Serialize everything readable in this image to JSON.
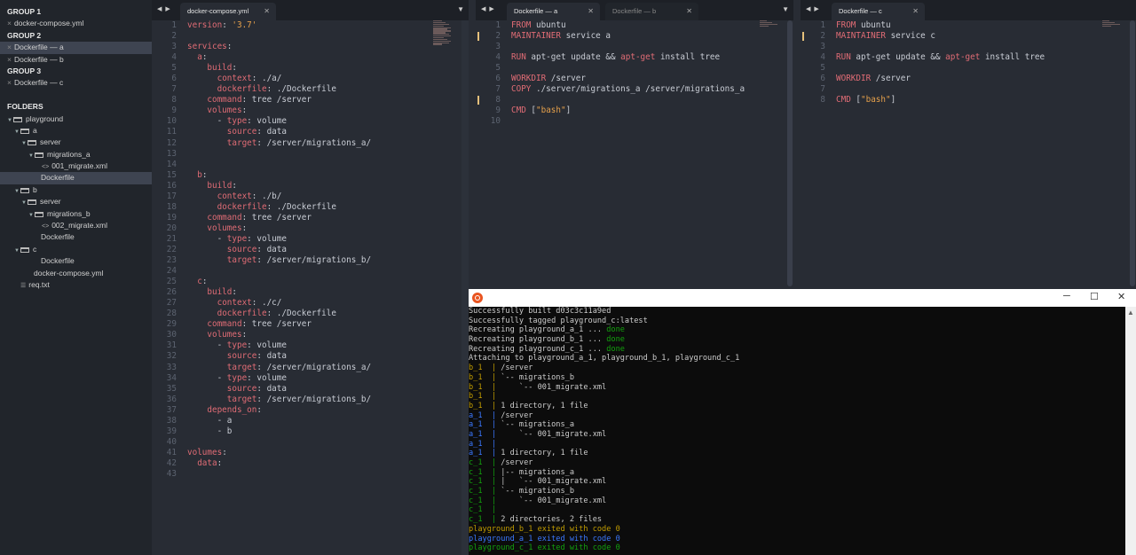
{
  "sidebar": {
    "group1": "GROUP 1",
    "group1_file": "docker-compose.yml",
    "group2": "GROUP 2",
    "group2_files": [
      "Dockerfile — a",
      "Dockerfile — b"
    ],
    "group3": "GROUP 3",
    "group3_file": "Dockerfile — c",
    "folders_header": "FOLDERS",
    "tree": [
      {
        "label": "playground",
        "kind": "folder",
        "depth": 0
      },
      {
        "label": "a",
        "kind": "folder",
        "depth": 1
      },
      {
        "label": "server",
        "kind": "folder",
        "depth": 2
      },
      {
        "label": "migrations_a",
        "kind": "folder",
        "depth": 3
      },
      {
        "label": "001_migrate.xml",
        "kind": "xml",
        "depth": 4
      },
      {
        "label": "Dockerfile",
        "kind": "file",
        "depth": 3
      },
      {
        "label": "b",
        "kind": "folder",
        "depth": 1
      },
      {
        "label": "server",
        "kind": "folder",
        "depth": 2
      },
      {
        "label": "migrations_b",
        "kind": "folder",
        "depth": 3
      },
      {
        "label": "002_migrate.xml",
        "kind": "xml",
        "depth": 4
      },
      {
        "label": "Dockerfile",
        "kind": "file",
        "depth": 3
      },
      {
        "label": "c",
        "kind": "folder",
        "depth": 1
      },
      {
        "label": "Dockerfile",
        "kind": "file",
        "depth": 3
      },
      {
        "label": "docker-compose.yml",
        "kind": "file",
        "depth": 2
      },
      {
        "label": "req.txt",
        "kind": "txt",
        "depth": 1
      }
    ]
  },
  "pane1": {
    "tab": "docker-compose.yml",
    "lines": [
      [
        [
          "k",
          "version"
        ],
        [
          "t",
          ": "
        ],
        [
          "s",
          "'3.7'"
        ]
      ],
      [],
      [
        [
          "k",
          "services"
        ],
        [
          "t",
          ":"
        ]
      ],
      [
        [
          "t",
          "  "
        ],
        [
          "k",
          "a"
        ],
        [
          "t",
          ":"
        ]
      ],
      [
        [
          "t",
          "    "
        ],
        [
          "k",
          "build"
        ],
        [
          "t",
          ":"
        ]
      ],
      [
        [
          "t",
          "      "
        ],
        [
          "k",
          "context"
        ],
        [
          "t",
          ": ./a/"
        ]
      ],
      [
        [
          "t",
          "      "
        ],
        [
          "k",
          "dockerfile"
        ],
        [
          "t",
          ": ./Dockerfile"
        ]
      ],
      [
        [
          "t",
          "    "
        ],
        [
          "k",
          "command"
        ],
        [
          "t",
          ": tree /server"
        ]
      ],
      [
        [
          "t",
          "    "
        ],
        [
          "k",
          "volumes"
        ],
        [
          "t",
          ":"
        ]
      ],
      [
        [
          "t",
          "      - "
        ],
        [
          "k",
          "type"
        ],
        [
          "t",
          ": volume"
        ]
      ],
      [
        [
          "t",
          "        "
        ],
        [
          "k",
          "source"
        ],
        [
          "t",
          ": data"
        ]
      ],
      [
        [
          "t",
          "        "
        ],
        [
          "k",
          "target"
        ],
        [
          "t",
          ": /server/migrations_a/"
        ]
      ],
      [],
      [],
      [
        [
          "t",
          "  "
        ],
        [
          "k",
          "b"
        ],
        [
          "t",
          ":"
        ]
      ],
      [
        [
          "t",
          "    "
        ],
        [
          "k",
          "build"
        ],
        [
          "t",
          ":"
        ]
      ],
      [
        [
          "t",
          "      "
        ],
        [
          "k",
          "context"
        ],
        [
          "t",
          ": ./b/"
        ]
      ],
      [
        [
          "t",
          "      "
        ],
        [
          "k",
          "dockerfile"
        ],
        [
          "t",
          ": ./Dockerfile"
        ]
      ],
      [
        [
          "t",
          "    "
        ],
        [
          "k",
          "command"
        ],
        [
          "t",
          ": tree /server"
        ]
      ],
      [
        [
          "t",
          "    "
        ],
        [
          "k",
          "volumes"
        ],
        [
          "t",
          ":"
        ]
      ],
      [
        [
          "t",
          "      - "
        ],
        [
          "k",
          "type"
        ],
        [
          "t",
          ": volume"
        ]
      ],
      [
        [
          "t",
          "        "
        ],
        [
          "k",
          "source"
        ],
        [
          "t",
          ": data"
        ]
      ],
      [
        [
          "t",
          "        "
        ],
        [
          "k",
          "target"
        ],
        [
          "t",
          ": /server/migrations_b/"
        ]
      ],
      [],
      [
        [
          "t",
          "  "
        ],
        [
          "k",
          "c"
        ],
        [
          "t",
          ":"
        ]
      ],
      [
        [
          "t",
          "    "
        ],
        [
          "k",
          "build"
        ],
        [
          "t",
          ":"
        ]
      ],
      [
        [
          "t",
          "      "
        ],
        [
          "k",
          "context"
        ],
        [
          "t",
          ": ./c/"
        ]
      ],
      [
        [
          "t",
          "      "
        ],
        [
          "k",
          "dockerfile"
        ],
        [
          "t",
          ": ./Dockerfile"
        ]
      ],
      [
        [
          "t",
          "    "
        ],
        [
          "k",
          "command"
        ],
        [
          "t",
          ": tree /server"
        ]
      ],
      [
        [
          "t",
          "    "
        ],
        [
          "k",
          "volumes"
        ],
        [
          "t",
          ":"
        ]
      ],
      [
        [
          "t",
          "      - "
        ],
        [
          "k",
          "type"
        ],
        [
          "t",
          ": volume"
        ]
      ],
      [
        [
          "t",
          "        "
        ],
        [
          "k",
          "source"
        ],
        [
          "t",
          ": data"
        ]
      ],
      [
        [
          "t",
          "        "
        ],
        [
          "k",
          "target"
        ],
        [
          "t",
          ": /server/migrations_a/"
        ]
      ],
      [
        [
          "t",
          "      - "
        ],
        [
          "k",
          "type"
        ],
        [
          "t",
          ": volume"
        ]
      ],
      [
        [
          "t",
          "        "
        ],
        [
          "k",
          "source"
        ],
        [
          "t",
          ": data"
        ]
      ],
      [
        [
          "t",
          "        "
        ],
        [
          "k",
          "target"
        ],
        [
          "t",
          ": /server/migrations_b/"
        ]
      ],
      [
        [
          "t",
          "    "
        ],
        [
          "k",
          "depends_on"
        ],
        [
          "t",
          ":"
        ]
      ],
      [
        [
          "t",
          "      - a"
        ]
      ],
      [
        [
          "t",
          "      - b"
        ]
      ],
      [],
      [
        [
          "k",
          "volumes"
        ],
        [
          "t",
          ":"
        ]
      ],
      [
        [
          "t",
          "  "
        ],
        [
          "k",
          "data"
        ],
        [
          "t",
          ":"
        ]
      ],
      []
    ]
  },
  "pane2": {
    "tabs": [
      "Dockerfile — a",
      "Dockerfile — b"
    ],
    "modified_lines": [
      1,
      7
    ],
    "lines": [
      [
        [
          "k",
          "FROM"
        ],
        [
          "t",
          " ubuntu"
        ]
      ],
      [
        [
          "k",
          "MAINTAINER"
        ],
        [
          "t",
          " service a"
        ]
      ],
      [],
      [
        [
          "k",
          "RUN"
        ],
        [
          "t",
          " apt-get update && "
        ],
        [
          "k",
          "apt-get"
        ],
        [
          "t",
          " install tree"
        ]
      ],
      [],
      [
        [
          "k",
          "WORKDIR"
        ],
        [
          "t",
          " /server"
        ]
      ],
      [
        [
          "k",
          "COPY"
        ],
        [
          "t",
          " ./server/migrations_a /server/migrations_a"
        ]
      ],
      [],
      [
        [
          "k",
          "CMD"
        ],
        [
          "t",
          " ["
        ],
        [
          "s",
          "\"bash\""
        ],
        [
          "t",
          "]"
        ]
      ],
      []
    ]
  },
  "pane3": {
    "tab": "Dockerfile — c",
    "modified_lines": [
      1
    ],
    "lines": [
      [
        [
          "k",
          "FROM"
        ],
        [
          "t",
          " ubuntu"
        ]
      ],
      [
        [
          "k",
          "MAINTAINER"
        ],
        [
          "t",
          " service c"
        ]
      ],
      [],
      [
        [
          "k",
          "RUN"
        ],
        [
          "t",
          " apt-get update && "
        ],
        [
          "k",
          "apt-get"
        ],
        [
          "t",
          " install tree"
        ]
      ],
      [],
      [
        [
          "k",
          "WORKDIR"
        ],
        [
          "t",
          " /server"
        ]
      ],
      [],
      [
        [
          "k",
          "CMD"
        ],
        [
          "t",
          " ["
        ],
        [
          "s",
          "\"bash\""
        ],
        [
          "t",
          "]"
        ]
      ]
    ]
  },
  "terminal": {
    "controls": [
      "─",
      "☐",
      "✕"
    ],
    "lines": [
      [
        [
          "w",
          "Successfully built d03c3c11a9ed"
        ]
      ],
      [
        [
          "w",
          "Successfully tagged playground_c:latest"
        ]
      ],
      [
        [
          "w",
          "Recreating playground_a_1 ... "
        ],
        [
          "g",
          "done"
        ]
      ],
      [
        [
          "w",
          "Recreating playground_b_1 ... "
        ],
        [
          "g",
          "done"
        ]
      ],
      [
        [
          "w",
          "Recreating playground_c_1 ... "
        ],
        [
          "g",
          "done"
        ]
      ],
      [
        [
          "w",
          "Attaching to playground_a_1, playground_b_1, playground_c_1"
        ]
      ],
      [
        [
          "y",
          "b_1  | "
        ],
        [
          "w",
          "/server"
        ]
      ],
      [
        [
          "y",
          "b_1  | "
        ],
        [
          "w",
          "`-- migrations_b"
        ]
      ],
      [
        [
          "y",
          "b_1  | "
        ],
        [
          "w",
          "    `-- 001_migrate.xml"
        ]
      ],
      [
        [
          "y",
          "b_1  | "
        ]
      ],
      [
        [
          "y",
          "b_1  | "
        ],
        [
          "w",
          "1 directory, 1 file"
        ]
      ],
      [
        [
          "b",
          "a_1  | "
        ],
        [
          "w",
          "/server"
        ]
      ],
      [
        [
          "b",
          "a_1  | "
        ],
        [
          "w",
          "`-- migrations_a"
        ]
      ],
      [
        [
          "b",
          "a_1  | "
        ],
        [
          "w",
          "    `-- 001_migrate.xml"
        ]
      ],
      [
        [
          "b",
          "a_1  | "
        ]
      ],
      [
        [
          "b",
          "a_1  | "
        ],
        [
          "w",
          "1 directory, 1 file"
        ]
      ],
      [
        [
          "g",
          "c_1  | "
        ],
        [
          "w",
          "/server"
        ]
      ],
      [
        [
          "g",
          "c_1  | "
        ],
        [
          "w",
          "|-- migrations_a"
        ]
      ],
      [
        [
          "g",
          "c_1  | "
        ],
        [
          "w",
          "|   `-- 001_migrate.xml"
        ]
      ],
      [
        [
          "g",
          "c_1  | "
        ],
        [
          "w",
          "`-- migrations_b"
        ]
      ],
      [
        [
          "g",
          "c_1  | "
        ],
        [
          "w",
          "    `-- 001_migrate.xml"
        ]
      ],
      [
        [
          "g",
          "c_1  | "
        ]
      ],
      [
        [
          "g",
          "c_1  | "
        ],
        [
          "w",
          "2 directories, 2 files"
        ]
      ],
      [
        [
          "y",
          "playground_b_1 exited with code 0"
        ]
      ],
      [
        [
          "b",
          "playground_a_1 exited with code 0"
        ]
      ],
      [
        [
          "g",
          "playground_c_1 exited with code 0"
        ]
      ]
    ]
  },
  "colors": {
    "keyword": "#e06c75",
    "string": "#e5a04b",
    "modified": "#e5c07b",
    "sidebar_bg": "#21252b",
    "editor_bg": "#282c34"
  }
}
